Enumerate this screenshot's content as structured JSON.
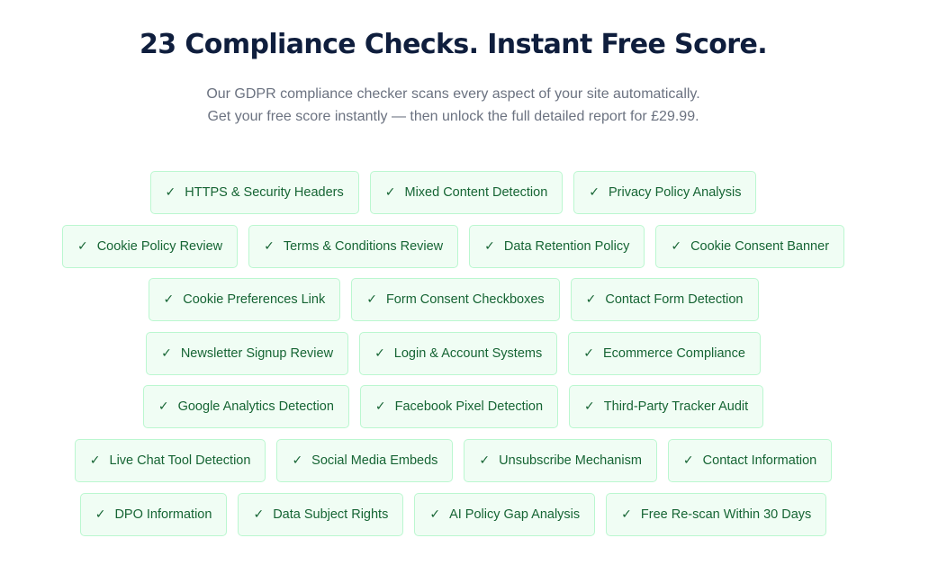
{
  "header": {
    "title": "23 Compliance Checks. Instant Free Score.",
    "subtitle_line1": "Our GDPR compliance checker scans every aspect of your site automatically.",
    "subtitle_line2": "Get your free score instantly — then unlock the full detailed report for £29.99."
  },
  "check_glyph": "✓",
  "colors": {
    "title": "#0f1e3d",
    "subtitle": "#6b7280",
    "chip_background": "#f0fdf4",
    "chip_border": "#bbf7d0",
    "chip_text": "#166534"
  },
  "rows": [
    [
      "HTTPS & Security Headers",
      "Mixed Content Detection",
      "Privacy Policy Analysis"
    ],
    [
      "Cookie Policy Review",
      "Terms & Conditions Review",
      "Data Retention Policy",
      "Cookie Consent Banner"
    ],
    [
      "Cookie Preferences Link",
      "Form Consent Checkboxes",
      "Contact Form Detection"
    ],
    [
      "Newsletter Signup Review",
      "Login & Account Systems",
      "Ecommerce Compliance"
    ],
    [
      "Google Analytics Detection",
      "Facebook Pixel Detection",
      "Third-Party Tracker Audit"
    ],
    [
      "Live Chat Tool Detection",
      "Social Media Embeds",
      "Unsubscribe Mechanism",
      "Contact Information"
    ],
    [
      "DPO Information",
      "Data Subject Rights",
      "AI Policy Gap Analysis",
      "Free Re-scan Within 30 Days"
    ]
  ]
}
